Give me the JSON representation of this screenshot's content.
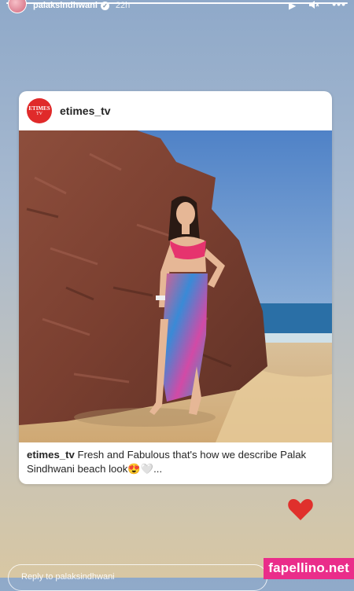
{
  "story": {
    "progress": 1.0,
    "username": "palaksindhwani",
    "time_ago": "22h",
    "controls": {
      "play": "▶",
      "mute": "✕",
      "more": "•••"
    }
  },
  "post": {
    "account": "etimes_tv",
    "logo_text_top": "ETIMES",
    "logo_text_bottom": "TV",
    "caption_user": "etimes_tv",
    "caption_text": "Fresh and Fabulous that's how we describe Palak Sindhwani beach look😍🤍..."
  },
  "reply": {
    "placeholder": "Reply to palaksindhwani"
  },
  "watermark": "fapellino.net",
  "colors": {
    "heart": "#e0302c",
    "logo": "#e02a2a",
    "watermark": "#ea2d8a"
  }
}
